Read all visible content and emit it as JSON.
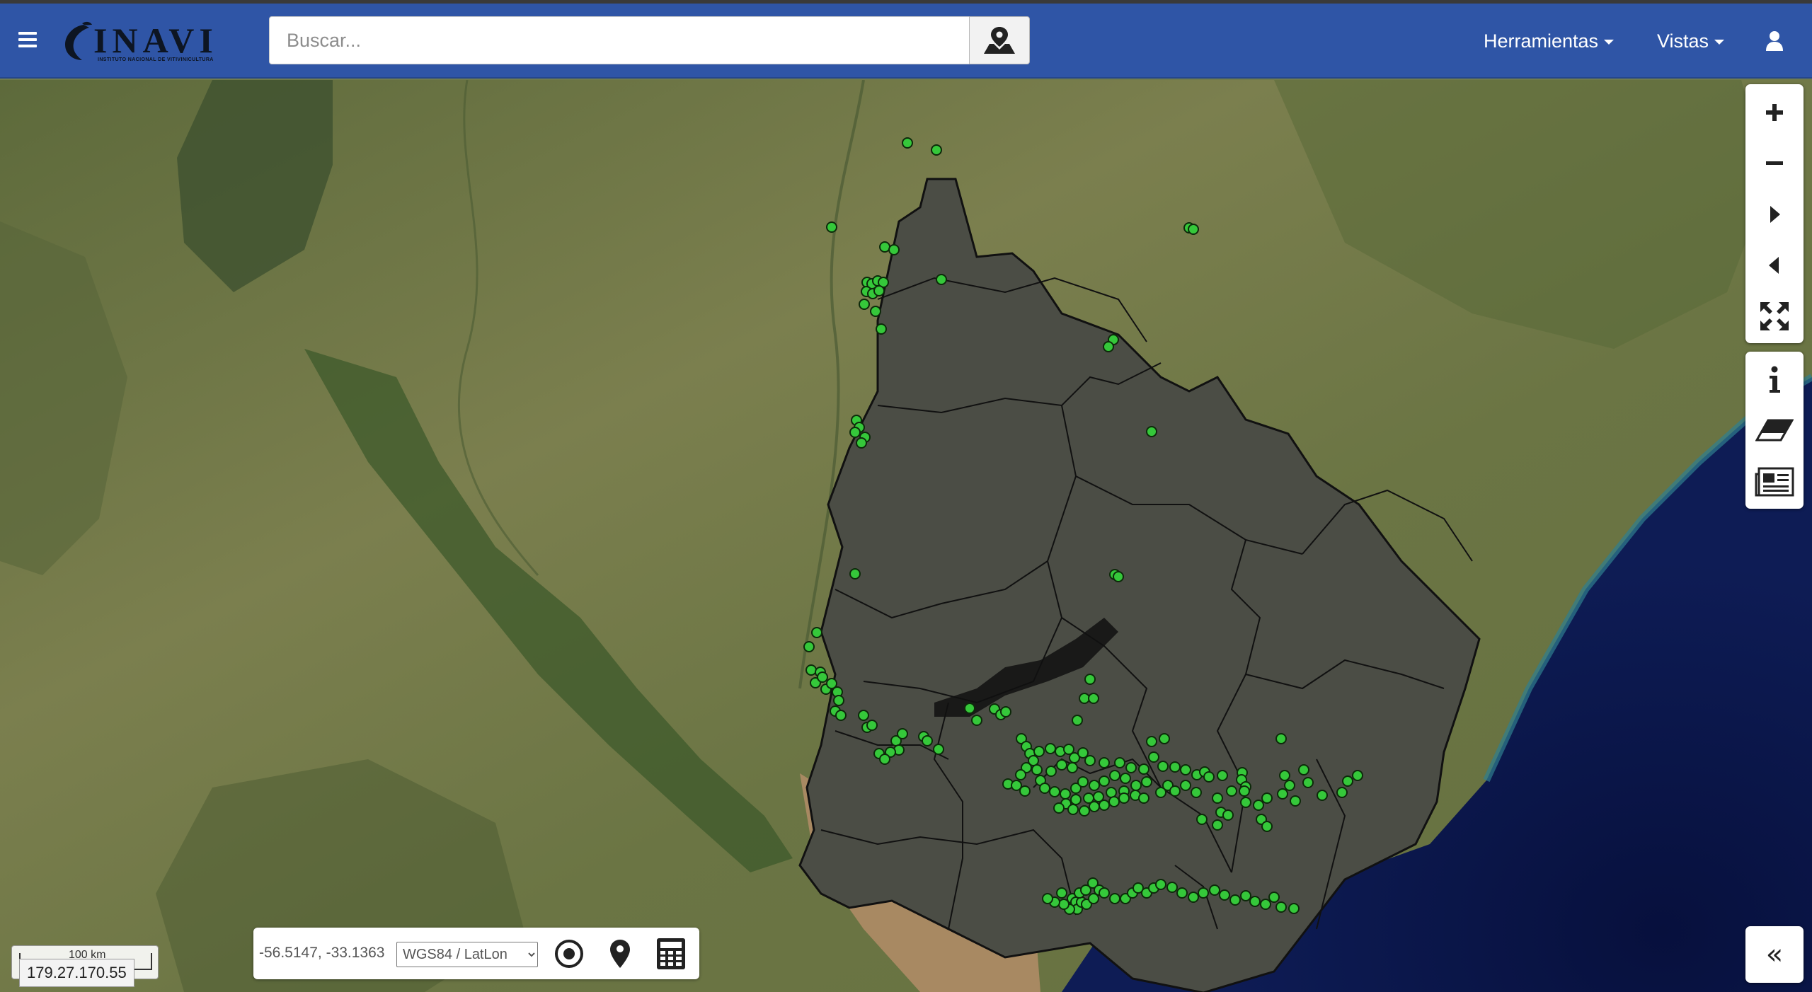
{
  "header": {
    "logo_text": "INAVI",
    "logo_subtitle": "INSTITUTO NACIONAL DE VITIVINICULTURA",
    "search_placeholder": "Buscar...",
    "menu_tools": "Herramientas",
    "menu_views": "Vistas"
  },
  "map": {
    "base_layer": "satellite imagery",
    "marker_color": "#35c83a"
  },
  "toolbar": {
    "nav": [
      "zoom-in",
      "zoom-out",
      "next-extent",
      "previous-extent",
      "full-extent"
    ],
    "tools": [
      "info",
      "eraser",
      "print"
    ]
  },
  "coordbar": {
    "coords": "-56.5147, -33.1363",
    "crs_selected": "WGS84 / LatLon"
  },
  "collapse_label": "«",
  "scale_label": "100 km",
  "ip_label": "179.27.170.55",
  "colors": {
    "navbar": "#2f55a6",
    "ocean": "#0a1446",
    "country_mask": "#4b4d45"
  }
}
